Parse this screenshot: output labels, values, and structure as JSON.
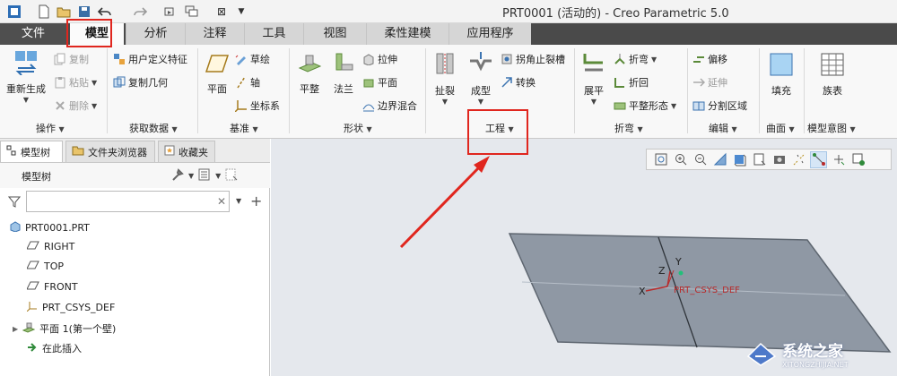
{
  "window": {
    "title": "PRT0001 (活动的) - Creo Parametric 5.0",
    "quick_access": {
      "close_x": "⊠"
    }
  },
  "tabs": [
    {
      "label": "文件"
    },
    {
      "label": "模型"
    },
    {
      "label": "分析"
    },
    {
      "label": "注释"
    },
    {
      "label": "工具"
    },
    {
      "label": "视图"
    },
    {
      "label": "柔性建模"
    },
    {
      "label": "应用程序"
    }
  ],
  "ribbon": {
    "operations": {
      "regenerate": "重新生成",
      "copy": "复制",
      "paste": "粘贴",
      "delete": "删除",
      "label": "操作"
    },
    "get_data": {
      "udf": "用户定义特征",
      "copy_geom": "复制几何",
      "label": "获取数据"
    },
    "datum": {
      "plane": "平面",
      "sketch": "草绘",
      "axis": "轴",
      "csys": "坐标系",
      "label": "基准"
    },
    "shapes": {
      "flat": "平整",
      "flange": "法兰",
      "extrude": "拉伸",
      "plane": "平面",
      "blend": "边界混合",
      "label": "形状"
    },
    "engineering": {
      "rip": "扯裂",
      "form": "成型",
      "corner_relief": "拐角止裂槽",
      "convert": "转换",
      "label": "工程"
    },
    "bends": {
      "unbend": "展平",
      "bend": "折弯",
      "bend_back": "折回",
      "flat_pattern": "平整形态",
      "label": "折弯"
    },
    "editing": {
      "offset": "偏移",
      "extend": "延伸",
      "split_area": "分割区域",
      "label": "编辑"
    },
    "surfaces": {
      "fill": "填充",
      "label": "曲面"
    },
    "model_intent": {
      "family_table": "族表",
      "label": "模型意图"
    }
  },
  "panel": {
    "tabs": [
      "模型树",
      "文件夹浏览器",
      "收藏夹"
    ],
    "tree_title": "模型树",
    "filter_placeholder": "",
    "items": [
      {
        "label": "PRT0001.PRT"
      },
      {
        "label": "RIGHT"
      },
      {
        "label": "TOP"
      },
      {
        "label": "FRONT"
      },
      {
        "label": "PRT_CSYS_DEF"
      },
      {
        "label": "平面 1(第一个壁)"
      },
      {
        "label": "在此插入"
      }
    ]
  },
  "graphics": {
    "axis_labels": {
      "z": "Z",
      "y": "Y",
      "x": "X"
    },
    "csys_label": "PRT_CSYS_DEF"
  },
  "watermark": {
    "text": "系统之家",
    "url": "XITONGZHIJIA.NET"
  },
  "colors": {
    "highlight": "#e0261e",
    "tab_bar": "#4a4a4a",
    "graphics_bg": "#e5e8ed",
    "sheet": "#8f98a4"
  }
}
